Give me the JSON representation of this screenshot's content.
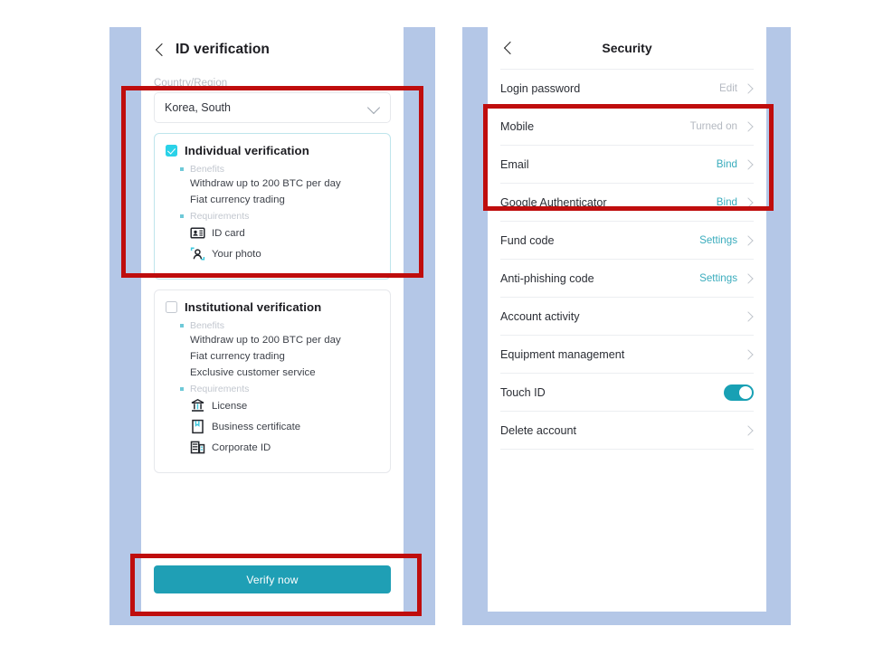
{
  "colors": {
    "frame": "#b4c7e7",
    "accent_teal": "#1f9fb5",
    "accent_cyan": "#2ad2e8",
    "link_teal": "#3aacbd",
    "annotation_red": "#bf0d0d",
    "muted_gray": "#b4b9c1"
  },
  "left_screen": {
    "nav": {
      "back_icon": "chevron-left-icon",
      "title": "ID verification"
    },
    "country_field": {
      "label": "Country/Region",
      "value": "Korea, South",
      "chevron_icon": "chevron-down-icon"
    },
    "cards": [
      {
        "id": "individual",
        "title": "Individual verification",
        "checked": true,
        "benefits_label": "Benefits",
        "benefits": [
          "Withdraw up to 200 BTC per day",
          "Fiat currency trading"
        ],
        "requirements_label": "Requirements",
        "requirements": [
          {
            "label": "ID card",
            "icon": "id-card-icon"
          },
          {
            "label": "Your photo",
            "icon": "portrait-photo-icon"
          }
        ]
      },
      {
        "id": "institutional",
        "title": "Institutional verification",
        "checked": false,
        "benefits_label": "Benefits",
        "benefits": [
          "Withdraw up to 200 BTC per day",
          "Fiat currency trading",
          "Exclusive customer service"
        ],
        "requirements_label": "Requirements",
        "requirements": [
          {
            "label": "License",
            "icon": "bank-license-icon"
          },
          {
            "label": "Business certificate",
            "icon": "document-certificate-icon"
          },
          {
            "label": "Corporate ID",
            "icon": "corporate-building-icon"
          }
        ]
      }
    ],
    "verify_button": "Verify now"
  },
  "right_screen": {
    "nav": {
      "back_icon": "chevron-left-icon",
      "title": "Security"
    },
    "rows": [
      {
        "label": "Login password",
        "value": "Edit",
        "value_style": "muted",
        "chevron": true,
        "toggle": false
      },
      {
        "label": "Mobile",
        "value": "Turned on",
        "value_style": "muted",
        "chevron": true,
        "toggle": false
      },
      {
        "label": "Email",
        "value": "Bind",
        "value_style": "link",
        "chevron": true,
        "toggle": false
      },
      {
        "label": "Google Authenticator",
        "value": "Bind",
        "value_style": "link",
        "chevron": true,
        "toggle": false
      },
      {
        "label": "Fund code",
        "value": "Settings",
        "value_style": "link",
        "chevron": true,
        "toggle": false
      },
      {
        "label": "Anti-phishing code",
        "value": "Settings",
        "value_style": "link",
        "chevron": true,
        "toggle": false
      },
      {
        "label": "Account activity",
        "value": "",
        "value_style": "muted",
        "chevron": true,
        "toggle": false
      },
      {
        "label": "Equipment management",
        "value": "",
        "value_style": "muted",
        "chevron": true,
        "toggle": false
      },
      {
        "label": "Touch ID",
        "value": "",
        "value_style": "muted",
        "chevron": false,
        "toggle": true
      },
      {
        "label": "Delete account",
        "value": "",
        "value_style": "muted",
        "chevron": true,
        "toggle": false
      }
    ]
  },
  "annotations": [
    {
      "name": "redbox-country-card"
    },
    {
      "name": "redbox-verify-btn"
    },
    {
      "name": "redbox-2fa-rows"
    }
  ]
}
